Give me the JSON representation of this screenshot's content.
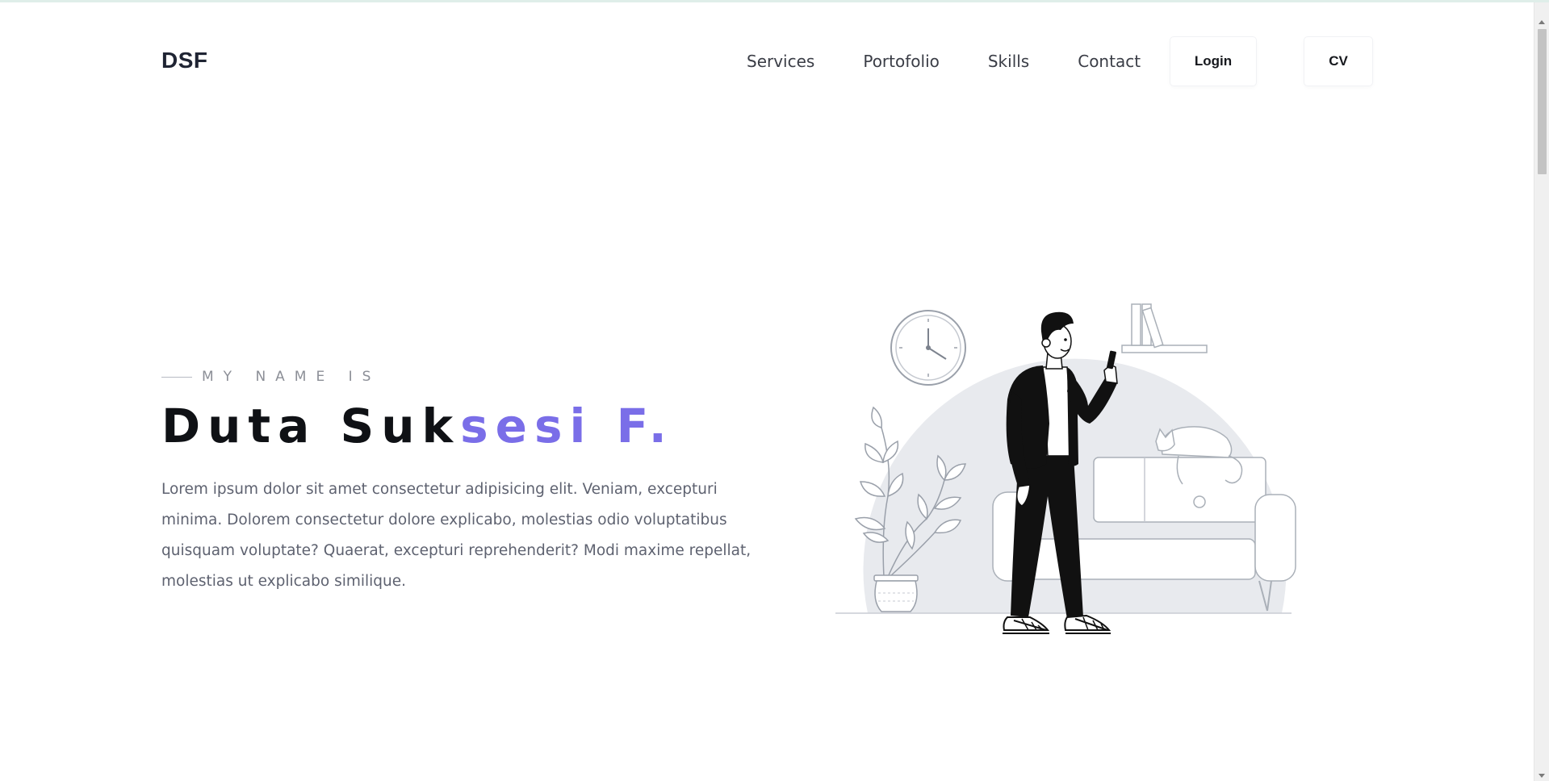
{
  "header": {
    "logo": "DSF",
    "nav": [
      "Services",
      "Portofolio",
      "Skills",
      "Contact"
    ],
    "login_label": "Login",
    "cv_label": "CV"
  },
  "hero": {
    "intro": "MY NAME IS",
    "name_plain": "Duta Suk",
    "name_accent": "sesi F.",
    "description": "Lorem ipsum dolor sit amet consectetur adipisicing elit. Veniam, excepturi minima. Dolorem consectetur dolore explicabo, molestias odio voluptatibus quisquam voluptate? Quaerat, excepturi reprehenderit? Modi maxime repellat, molestias ut explicabo similique."
  },
  "colors": {
    "accent": "#7a6ee8",
    "heading": "#0f1115",
    "body_text": "#5e6270",
    "illustration_bg": "#e8eaee"
  },
  "illustration": {
    "subject": "person-standing-with-phone-in-living-room",
    "icons": [
      "wall-clock-icon",
      "bookshelf-icon",
      "potted-plant-icon",
      "sofa-icon",
      "cat-icon"
    ]
  }
}
